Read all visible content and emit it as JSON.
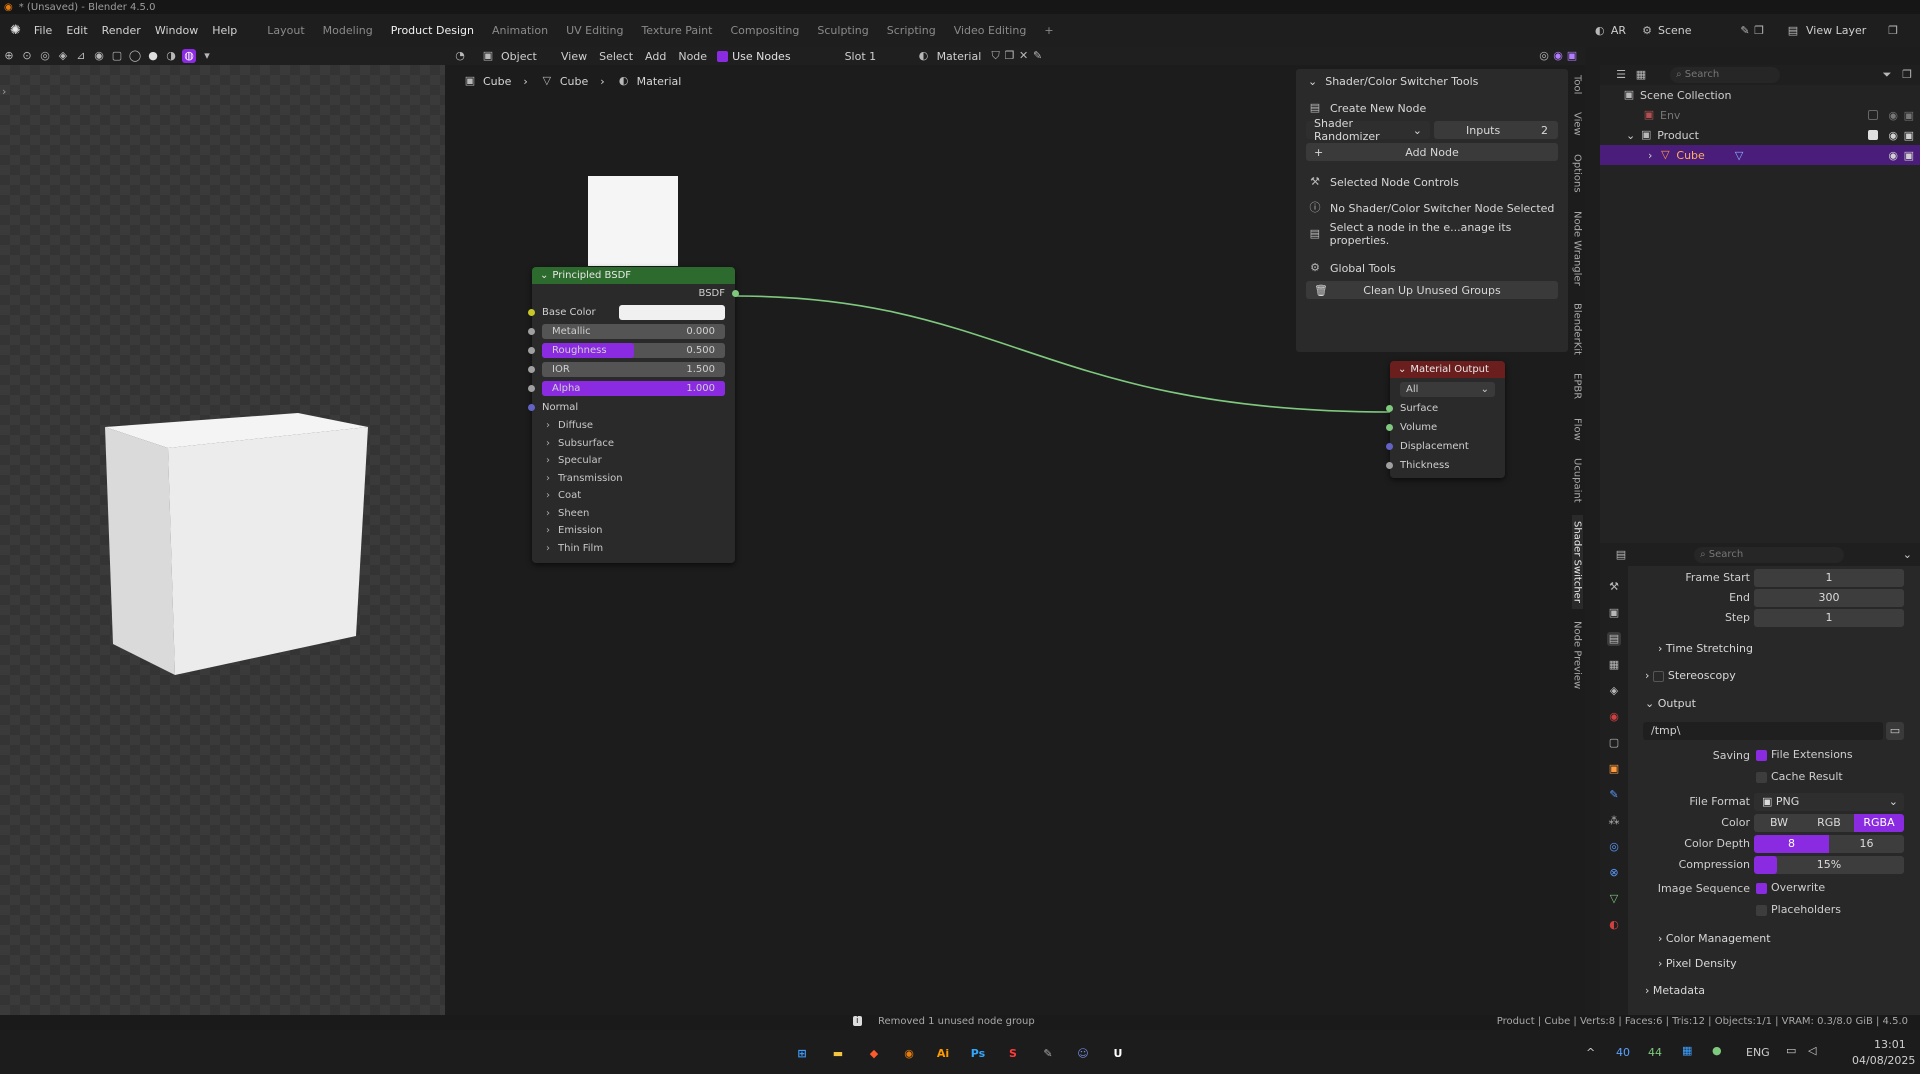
{
  "window": {
    "title": "* (Unsaved) - Blender 4.5.0"
  },
  "menu": [
    "File",
    "Edit",
    "Render",
    "Window",
    "Help"
  ],
  "workspaces": [
    "Layout",
    "Modeling",
    "Product Design",
    "Animation",
    "UV Editing",
    "Texture Paint",
    "Compositing",
    "Sculpting",
    "Scripting",
    "Video Editing"
  ],
  "active_workspace": "Product Design",
  "top_right": {
    "ar": "AR",
    "scene": "Scene",
    "view_layer": "View Layer"
  },
  "node_header": {
    "mode": "Object",
    "view": "View",
    "select": "Select",
    "add": "Add",
    "node": "Node",
    "use_nodes": "Use Nodes",
    "slot": "Slot 1",
    "material": "Material"
  },
  "breadcrumb": [
    "Cube",
    "Cube",
    "Material"
  ],
  "bsdf_node": {
    "title": "Principled BSDF",
    "output": "BSDF",
    "inputs": [
      {
        "label": "Base Color",
        "value": "",
        "type": "color"
      },
      {
        "label": "Metallic",
        "value": "0.000",
        "fill": 0
      },
      {
        "label": "Roughness",
        "value": "0.500",
        "fill": 0.5
      },
      {
        "label": "IOR",
        "value": "1.500",
        "fill": 0
      },
      {
        "label": "Alpha",
        "value": "1.000",
        "fill": 1
      },
      {
        "label": "Normal",
        "value": "",
        "type": "vector"
      }
    ],
    "panels": [
      "Diffuse",
      "Subsurface",
      "Specular",
      "Transmission",
      "Coat",
      "Sheen",
      "Emission",
      "Thin Film"
    ]
  },
  "output_node": {
    "title": "Material Output",
    "target": "All",
    "inputs": [
      "Surface",
      "Volume",
      "Displacement",
      "Thickness"
    ]
  },
  "side_panel": {
    "title": "Shader/Color Switcher Tools",
    "create_new_node": "Create New Node",
    "node_type": "Shader Randomizer",
    "inputs_label": "Inputs",
    "inputs_value": "2",
    "add_node": "Add Node",
    "selected_controls": "Selected Node Controls",
    "no_selection": "No Shader/Color Switcher Node Selected",
    "select_hint": "Select a node in the e...anage its properties.",
    "global_tools": "Global Tools",
    "cleanup": "Clean Up Unused Groups"
  },
  "side_tabs": [
    "Tool",
    "View",
    "Options",
    "Node Wrangler",
    "BlenderKit",
    "EPBR",
    "Flow",
    "Ucupaint",
    "Shader Switcher",
    "Node Preview"
  ],
  "outliner": {
    "search_placeholder": "Search",
    "root": "Scene Collection",
    "items": [
      "Env",
      "Product",
      "Cube"
    ]
  },
  "properties": {
    "search_placeholder": "Search",
    "frame_start_label": "Frame Start",
    "frame_start": "1",
    "end_label": "End",
    "end": "300",
    "step_label": "Step",
    "step": "1",
    "time_stretching": "Time Stretching",
    "stereoscopy": "Stereoscopy",
    "output": "Output",
    "path": "/tmp\\",
    "saving_label": "Saving",
    "file_extensions": "File Extensions",
    "cache_result": "Cache Result",
    "file_format_label": "File Format",
    "file_format": "PNG",
    "color_label": "Color",
    "color_opts": [
      "BW",
      "RGB",
      "RGBA"
    ],
    "color_depth_label": "Color Depth",
    "color_depth_opts": [
      "8",
      "16"
    ],
    "compression_label": "Compression",
    "compression": "15%",
    "compression_fill": 0.15,
    "image_sequence_label": "Image Sequence",
    "overwrite": "Overwrite",
    "placeholders": "Placeholders",
    "color_management": "Color Management",
    "pixel_density": "Pixel Density",
    "metadata": "Metadata"
  },
  "status": {
    "message": "Removed 1 unused node group",
    "stats": "Product | Cube | Verts:8 | Faces:6 | Tris:12 | Objects:1/1 | VRAM: 0.3/8.0 GiB | 4.5.0"
  },
  "taskbar": {
    "temp1": "40",
    "temp2": "44",
    "lang": "ENG",
    "time": "13:01",
    "date": "04/08/2025"
  },
  "colors": {
    "accent": "#8a2be2",
    "bsdf_header": "#2d6a2d",
    "output_header": "#6b1e1e",
    "link": "#7fc97f",
    "selected_row": "#4a1d7a"
  }
}
